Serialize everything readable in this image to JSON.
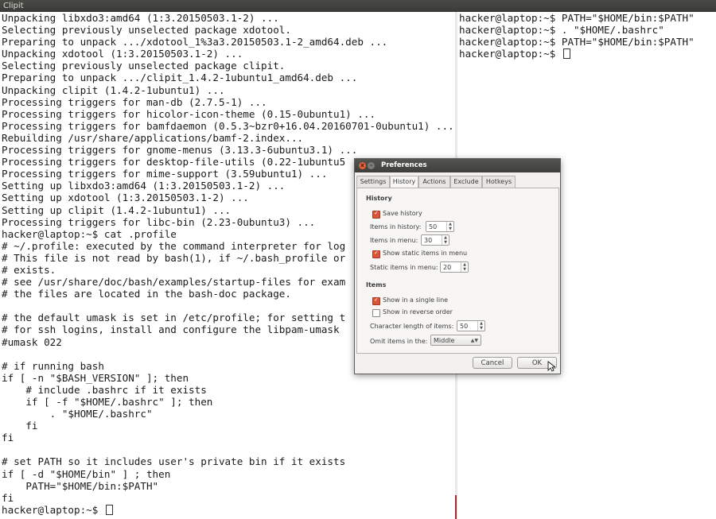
{
  "window": {
    "title": "Clipit"
  },
  "left_terminal": {
    "lines": [
      "Unpacking libxdo3:amd64 (1:3.20150503.1-2) ...",
      "Selecting previously unselected package xdotool.",
      "Preparing to unpack .../xdotool_1%3a3.20150503.1-2_amd64.deb ...",
      "Unpacking xdotool (1:3.20150503.1-2) ...",
      "Selecting previously unselected package clipit.",
      "Preparing to unpack .../clipit_1.4.2-1ubuntu1_amd64.deb ...",
      "Unpacking clipit (1.4.2-1ubuntu1) ...",
      "Processing triggers for man-db (2.7.5-1) ...",
      "Processing triggers for hicolor-icon-theme (0.15-0ubuntu1) ...",
      "Processing triggers for bamfdaemon (0.5.3~bzr0+16.04.20160701-0ubuntu1) ...",
      "Rebuilding /usr/share/applications/bamf-2.index...",
      "Processing triggers for gnome-menus (3.13.3-6ubuntu3.1) ...",
      "Processing triggers for desktop-file-utils (0.22-1ubuntu5",
      "Processing triggers for mime-support (3.59ubuntu1) ...",
      "Setting up libxdo3:amd64 (1:3.20150503.1-2) ...",
      "Setting up xdotool (1:3.20150503.1-2) ...",
      "Setting up clipit (1.4.2-1ubuntu1) ...",
      "Processing triggers for libc-bin (2.23-0ubuntu3) ...",
      "hacker@laptop:~$ cat .profile",
      "# ~/.profile: executed by the command interpreter for log",
      "# This file is not read by bash(1), if ~/.bash_profile or",
      "# exists.",
      "# see /usr/share/doc/bash/examples/startup-files for exam",
      "# the files are located in the bash-doc package.",
      "",
      "# the default umask is set in /etc/profile; for setting t",
      "# for ssh logins, install and configure the libpam-umask",
      "#umask 022",
      "",
      "# if running bash",
      "if [ -n \"$BASH_VERSION\" ]; then",
      "    # include .bashrc if it exists",
      "    if [ -f \"$HOME/.bashrc\" ]; then",
      "        . \"$HOME/.bashrc\"",
      "    fi",
      "fi",
      "",
      "# set PATH so it includes user's private bin if it exists",
      "if [ -d \"$HOME/bin\" ] ; then",
      "    PATH=\"$HOME/bin:$PATH\"",
      "fi"
    ],
    "prompt": "hacker@laptop:~$ "
  },
  "right_terminal": {
    "lines": [
      "hacker@laptop:~$ PATH=\"$HOME/bin:$PATH\"",
      "hacker@laptop:~$ . \"$HOME/.bashrc\"",
      "hacker@laptop:~$ PATH=\"$HOME/bin:$PATH\""
    ],
    "prompt": "hacker@laptop:~$ "
  },
  "dialog": {
    "title": "Preferences",
    "close_glyph": "x",
    "min_glyph": "–",
    "tabs": [
      "Settings",
      "History",
      "Actions",
      "Exclude",
      "Hotkeys"
    ],
    "active_tab": "History",
    "history": {
      "section": "History",
      "save_history": {
        "label": "Save history",
        "checked": true
      },
      "items_in_history": {
        "label": "Items in history:",
        "value": "50"
      },
      "items_in_menu": {
        "label": "Items in menu:",
        "value": "30"
      },
      "show_static": {
        "label": "Show static items in menu",
        "checked": true
      },
      "static_items": {
        "label": "Static items in menu:",
        "value": "20"
      }
    },
    "items": {
      "section": "Items",
      "single_line": {
        "label": "Show in a single line",
        "checked": true
      },
      "reverse_order": {
        "label": "Show in reverse order",
        "checked": false
      },
      "char_length": {
        "label": "Character length of items:",
        "value": "50"
      },
      "omit": {
        "label": "Omit items in the:",
        "value": "Middle"
      }
    },
    "cancel_label": "Cancel",
    "ok_label": "OK"
  },
  "colors": {
    "titlebar": "#3e3e3b",
    "checkbox_on": "#d8553a",
    "close_button": "#e2603a"
  }
}
